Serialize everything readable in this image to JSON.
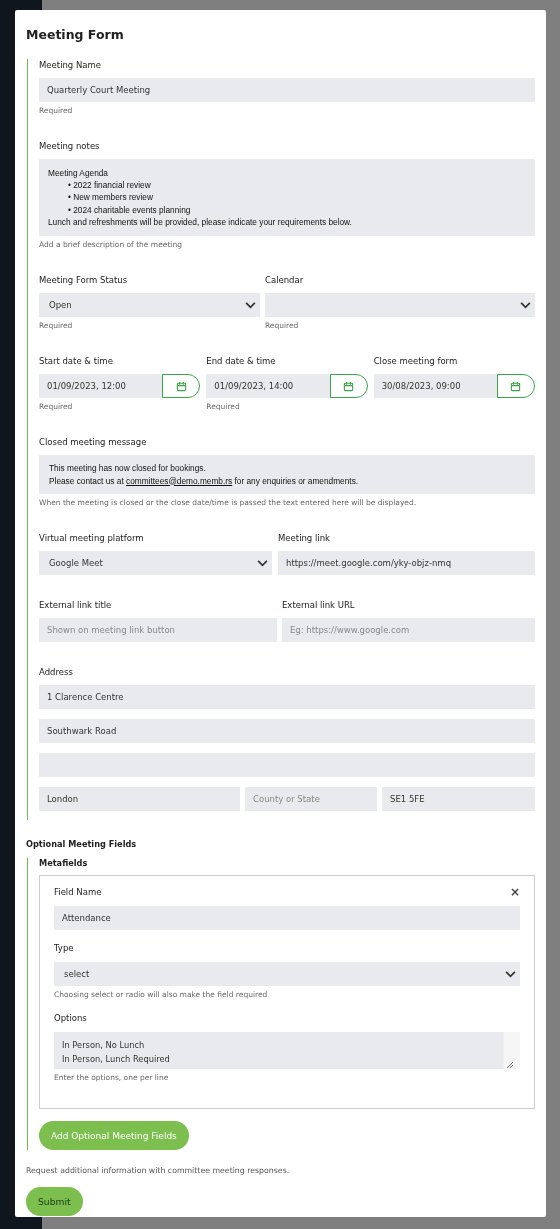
{
  "modal": {
    "title": "Meeting Form"
  },
  "meeting_name": {
    "label": "Meeting Name",
    "value": "Quarterly Court Meeting",
    "hint": "Required"
  },
  "meeting_notes": {
    "label": "Meeting notes",
    "lines": [
      {
        "kind": "plain",
        "text": "Meeting Agenda"
      },
      {
        "kind": "bullet",
        "text": "• 2022 financial review"
      },
      {
        "kind": "bullet",
        "text": "• New members review"
      },
      {
        "kind": "bullet",
        "text": "• 2024 charitable events planning"
      },
      {
        "kind": "plain",
        "text": "Lunch and refreshments will be provided, please indicate your requirements below."
      }
    ],
    "hint": "Add a brief description of the meeting"
  },
  "status": {
    "label": "Meeting Form Status",
    "value": "Open",
    "hint": "Required"
  },
  "calendar": {
    "label": "Calendar",
    "hint": "Required"
  },
  "dates": [
    {
      "label": "Start date & time",
      "value": "01/09/2023, 12:00",
      "hint": "Required"
    },
    {
      "label": "End date & time",
      "value": "01/09/2023, 14:00",
      "hint": "Required"
    },
    {
      "label": "Close meeting form",
      "value": "30/08/2023, 09:00"
    }
  ],
  "closed_message": {
    "label": "Closed meeting message",
    "line_1": "This meeting has now closed for bookings.",
    "line_2_before": "Please contact us at ",
    "line_2_link": "committees@demo.memb.rs",
    "line_2_after": " for any enquiries or amendments.",
    "hint": "When the meeting is closed or the close date/time is passed the text entered here will be displayed."
  },
  "virtual_platform": {
    "label": "Virtual meeting platform",
    "value": "Google Meet"
  },
  "meeting_link": {
    "label": "Meeting link",
    "value": "https://meet.google.com/yky-objz-nmq"
  },
  "external_link_title": {
    "label": "External link title",
    "placeholder": "Shown on meeting link button"
  },
  "external_link_url": {
    "label": "External link URL",
    "placeholder": "Eg: https://www.google.com"
  },
  "address": {
    "label": "Address",
    "line_1": "1 Clarence Centre",
    "line_2": "Southwark Road",
    "city": "London",
    "county_placeholder": "County or State",
    "postcode": "SE1 5FE"
  },
  "optional_section": {
    "title": "Optional Meeting Fields",
    "subtitle": "Metafields",
    "metafield": {
      "name_label": "Field Name",
      "name_value": "Attendance",
      "close": "×",
      "type_label": "Type",
      "type_value": "select",
      "type_hint": "Choosing select or radio will also make the field required",
      "options_label": "Options",
      "options": [
        "In Person, No Lunch",
        "In Person, Lunch Required"
      ],
      "options_hint": "Enter the options, one per line"
    },
    "add_button": "Add Optional Meeting Fields"
  },
  "section_hint": "Request additional information with committee meeting responses.",
  "submit": "Submit"
}
